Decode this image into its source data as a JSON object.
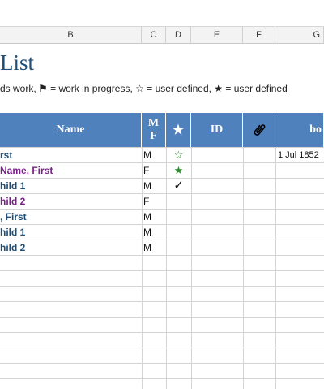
{
  "columns": [
    "B",
    "C",
    "D",
    "E",
    "F",
    "G"
  ],
  "title": "List",
  "legend": "ds work, ⚑ = work in progress, ☆ = user defined, ★ = user defined",
  "header": {
    "name": "Name",
    "mf_m": "M",
    "mf_f": "F",
    "star": "★",
    "id": "ID",
    "born": "bo"
  },
  "colors": {
    "header_bg": "#4f81bd",
    "male": "#1f4e79",
    "female": "#7b1f8a",
    "title": "#1f4e79"
  },
  "rows": [
    {
      "name": "rst",
      "sex": "M",
      "mark": "☆",
      "born": "1 Jul 1852",
      "color": "#1f4e79"
    },
    {
      "name": "Name, First",
      "sex": "F",
      "mark": "★",
      "born": "",
      "color": "#7b1f8a"
    },
    {
      "name": "hild 1",
      "sex": "M",
      "mark": "✓",
      "born": "",
      "color": "#1f4e79"
    },
    {
      "name": "hild 2",
      "sex": "F",
      "mark": "",
      "born": "",
      "color": "#7b1f8a"
    },
    {
      "name": ", First",
      "sex": "M",
      "mark": "",
      "born": "",
      "color": "#1f4e79"
    },
    {
      "name": "hild 1",
      "sex": "M",
      "mark": "",
      "born": "",
      "color": "#1f4e79"
    },
    {
      "name": "hild 2",
      "sex": "M",
      "mark": "",
      "born": "",
      "color": "#1f4e79"
    }
  ]
}
